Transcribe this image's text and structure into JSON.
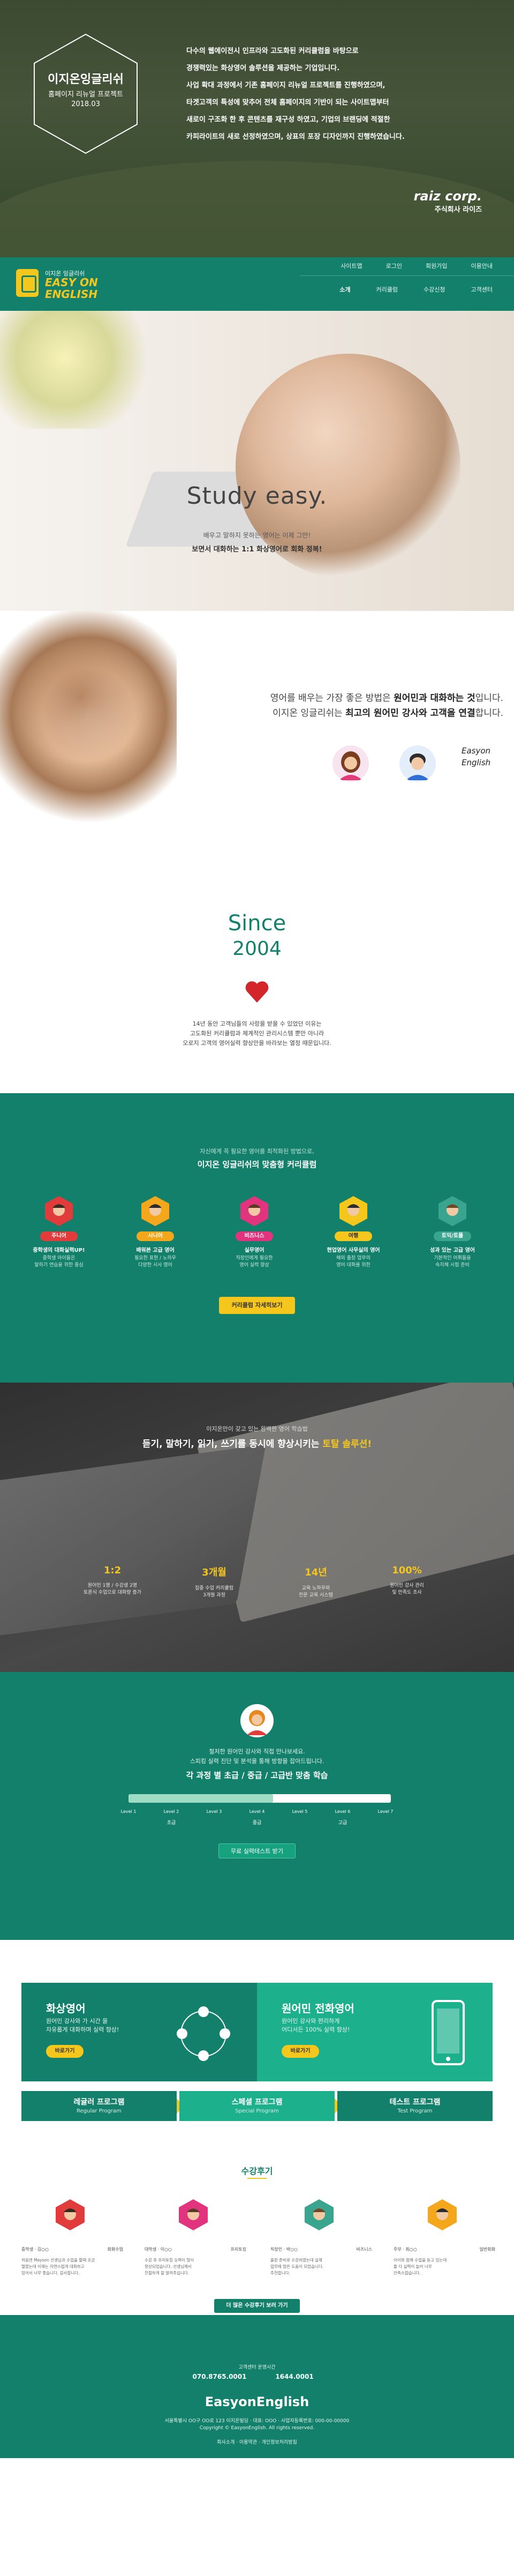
{
  "intro": {
    "hex_title": "이지온잉글리쉬",
    "hex_sub1": "홈페이지 리뉴얼 프로젝트",
    "hex_sub2": "2018.03",
    "paragraph": [
      "다수의 웹에이전시 인프라와 고도화된 커리큘럼을 바탕으로",
      "경쟁력있는 화상영어 솔루션을 제공하는 기업입니다.",
      "사업 확대 과정에서 기존 홈페이지 리뉴얼 프로젝트를 진행하였으며,",
      "타겟고객의 특성에 맞추어 전체 홈페이지의 기반이 되는 사이트맵부터",
      "새로이 구조화 한 후 콘텐츠를 재구성 하였고, 기업의 브랜딩에 적절한",
      "카피라이트의 새로 선정하였으며, 상표의 포장 디자인까지 진행하였습니다."
    ],
    "company_logo": "raiz corp.",
    "company_name": "주식회사 라이즈"
  },
  "header": {
    "logo_small": "이지온 잉글리쉬",
    "logo_line1": "EASY ON",
    "logo_line2": "ENGLISH",
    "top_nav": [
      "사이트맵",
      "로그인",
      "회원가입",
      "이용안내"
    ],
    "main_nav": [
      "소개",
      "커리큘럼",
      "수강신청",
      "고객센터"
    ]
  },
  "hero": {
    "title": "Study easy.",
    "sub1": "배우고 말하지 못하는 영어는 이제 그만!",
    "sub2": "보면서 대화하는 1:1 화상영어로 회화 정복!"
  },
  "native": {
    "line1_pre": "영어를 배우는 가장 좋은 방법은 ",
    "line1_bold": "원어민과 대화하는 것",
    "line1_post": "입니다.",
    "line2_pre": "이지온 잉글리쉬는 ",
    "line2_bold": "최고의 원어민 강사와 고객을 연결",
    "line2_post": "합니다.",
    "sign1": "Easyon",
    "sign2": "English"
  },
  "since": {
    "label": "Since",
    "year": "2004",
    "text": [
      "14년 동안 고객님들의 사랑을 받을 수 있었던 이유는",
      "고도화된 커리큘럼과 체계적인 관리시스템 뿐만 아니라",
      "오로지 고객의 영어실력 향상만을 바라보는 열정 때문입니다."
    ]
  },
  "curriculum": {
    "kicker": "자신에게 꼭 필요한 영어를 최적화된 방법으로,",
    "title": "이지온 잉글리쉬의 맞춤형 커리큘럼",
    "items": [
      {
        "badge": "주니어",
        "name": "중학생의 대화실력UP!",
        "desc": [
          "중학생 아이들은",
          "말하기 연습을 위한 중심"
        ],
        "color": "#e23b3b"
      },
      {
        "badge": "시니어",
        "name": "배워본 고급 영어",
        "desc": [
          "필요한 표현 / 노하우",
          "다양한 시사 영어"
        ],
        "color": "#f5a71b"
      },
      {
        "badge": "비즈니스",
        "name": "실무영어",
        "desc": [
          "직장인에게 필요한",
          "영어 실력 향상"
        ],
        "color": "#e2337e"
      },
      {
        "badge": "여행",
        "name": "현업영어 사무실의 영어",
        "desc": [
          "해외 출장 업무의",
          "영어 대화를 위한"
        ],
        "color": "#f5c61b"
      },
      {
        "badge": "토익/토플",
        "name": "성과 있는 고급 영어",
        "desc": [
          "기본적인 어휘들을",
          "숙지해 시험 준비"
        ],
        "color": "#3aa58e"
      }
    ],
    "button": "커리큘럼 자세히보기"
  },
  "skills": {
    "kicker": "이지온만이 갖고 있는 완벽한 영어 학습법",
    "title_pre": "듣기, 말하기, 읽기, 쓰기를 동시에 향상시키는 ",
    "title_hi": "토탈 솔루션!",
    "stats": [
      {
        "num": "1:2",
        "desc": [
          "원어민 1명 / 수강생 2명",
          "토론식 수업으로 대화량 증가"
        ]
      },
      {
        "num": "3개월",
        "desc": [
          "집중 수업 커리큘럼",
          "3개월 과정"
        ]
      },
      {
        "num": "14년",
        "desc": [
          "교육 노하우와",
          "전문 교육 시스템"
        ]
      },
      {
        "num": "100%",
        "desc": [
          "원어민 강사 관리",
          "및 만족도 조사"
        ]
      }
    ]
  },
  "level": {
    "line1": "철저한 원어민 강사와 직접 만나보세요.",
    "line2": "스피킹 실력 진단 및 분석을 통해 방향을 잡아드립니다.",
    "title": "각 과정 별 초급 / 중급 / 고급반 맞춤 학습",
    "progress": 0.55,
    "levels": [
      "Level 1",
      "Level 2",
      "Level 3",
      "Level 4",
      "Level 5",
      "Level 6",
      "Level 7"
    ],
    "bands": [
      "초급",
      "중급",
      "고급"
    ],
    "button": "무료 실력테스트 받기"
  },
  "programs": {
    "box1": {
      "title": "화상영어",
      "desc": [
        "원어민 강사와 가 시간 을",
        "자유롭게 대화하며 실력 향상!"
      ],
      "button": "바로가기"
    },
    "box2": {
      "title": "원어민 전화영어",
      "desc": [
        "원어민 강사와 편리하게",
        "어디서든 100% 실력 향상!"
      ],
      "button": "바로가기"
    },
    "tabs": [
      {
        "kr": "레귤러 프로그램",
        "en": "Regular Program"
      },
      {
        "kr": "스페셜 프로그램",
        "en": "Special Program"
      },
      {
        "kr": "테스트 프로그램",
        "en": "Test Program"
      }
    ],
    "reviews_title": "수강후기",
    "reviews": [
      {
        "name": "중학생 · 김○○",
        "tag": "회화수업",
        "text": [
          "처음엔 Mayson 선생님과 수업을 할때 조금",
          "떨렸는데 이제는 자연스럽게 대화하고",
          "있어서 너무 좋습니다. 감사합니다."
        ],
        "color": "#e23b3b"
      },
      {
        "name": "대학생 · 이○○",
        "tag": "프리토킹",
        "text": [
          "수강 후 프리토킹 능력이 많이",
          "향상되었습니다. 선생님께서",
          "친절하게 잘 알려주십니다."
        ],
        "color": "#e2337e"
      },
      {
        "name": "직장인 · 박○○",
        "tag": "비즈니스",
        "text": [
          "출장 준비로 수강하였는데 실제",
          "업무에 많은 도움이 되었습니다.",
          "추천합니다."
        ],
        "color": "#3aa58e"
      },
      {
        "name": "주부 · 최○○",
        "tag": "일반회화",
        "text": [
          "아이와 함께 수업을 듣고 있는데",
          "둘 다 실력이 늘어 너무",
          "만족스럽습니다."
        ],
        "color": "#f5a71b"
      }
    ],
    "reviews_button": "더 많은 수강후기 보러 가기"
  },
  "footer": {
    "line1": "고객센터 운영시간",
    "phone1": "070.8765.0001",
    "phone2": "1644.0001",
    "brand": "EasyonEnglish",
    "address": "서울특별시 OO구 OO로 123 이지온빌딩 · 대표: OOO · 사업자등록번호: 000-00-00000",
    "copyright": "Copyright © EasyonEnglish. All rights reserved.",
    "links": [
      "회사소개",
      "이용약관",
      "개인정보처리방침"
    ]
  }
}
